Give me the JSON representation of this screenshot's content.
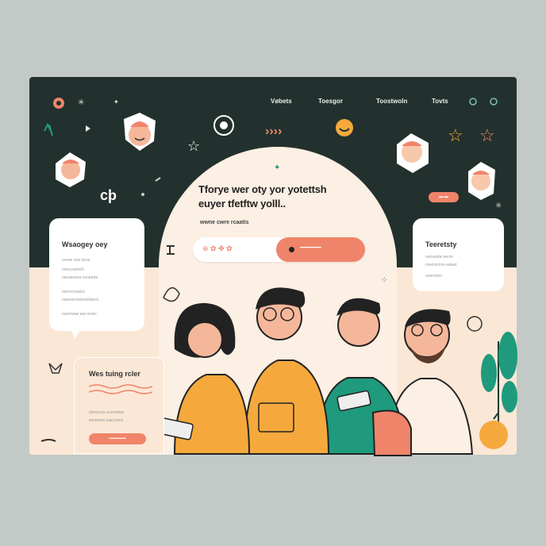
{
  "nav": {
    "items": [
      "Vøbets",
      "Toesgor",
      "Toostwoln",
      "Tovts"
    ]
  },
  "hero": {
    "headline_line1": "Tforye wer oty yor yotettsh",
    "headline_line2": "euyer tfetftw yolll..",
    "subline": "wwne cwre rcaatis",
    "search_icons": "⊕ ✿ ✤ ✿",
    "search_button_label": "━━━━━━━━"
  },
  "card_left": {
    "title": "Wsaogey oey",
    "lines": [
      "vvnoe noa tsroe",
      "ovteccwmeh",
      "oevaeveea nvoeerte",
      "ewrrocosalvc",
      "owewersrewoinlaevs",
      "ewmrwae ww ooetv"
    ]
  },
  "card_right": {
    "title": "Teeretsty",
    "lines": [
      "oeosestw eerns",
      "cewnccnrw eslaet",
      "ooeromrc"
    ]
  },
  "card_bottom": {
    "title": "Wes tuing rcler",
    "lines": [
      "oemrrcce eermnees",
      "wemreon wacrcees"
    ],
    "button_label": "━━━━━━━"
  },
  "top_pill": "▬ ▬",
  "logo_mark": "cþ",
  "colors": {
    "dark": "#22312d",
    "peach": "#fbe7d6",
    "accent": "#f0846a",
    "yellow": "#f5a93c",
    "green": "#1f9a7d"
  }
}
